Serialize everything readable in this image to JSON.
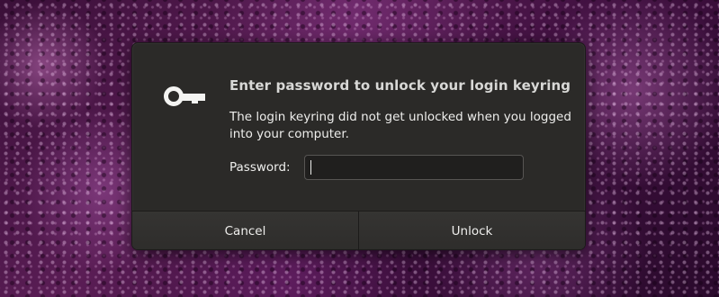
{
  "dialog": {
    "icon": "keyring-key-icon",
    "title": "Enter password to unlock your login keyring",
    "message": "The login keyring did not get unlocked when you logged into your computer.",
    "password_label": "Password:",
    "password_value": "",
    "cancel_label": "Cancel",
    "unlock_label": "Unlock"
  },
  "colors": {
    "dialog_bg": "#2b2a28",
    "text": "#eeeeec",
    "wallpaper": "#4a1545"
  }
}
